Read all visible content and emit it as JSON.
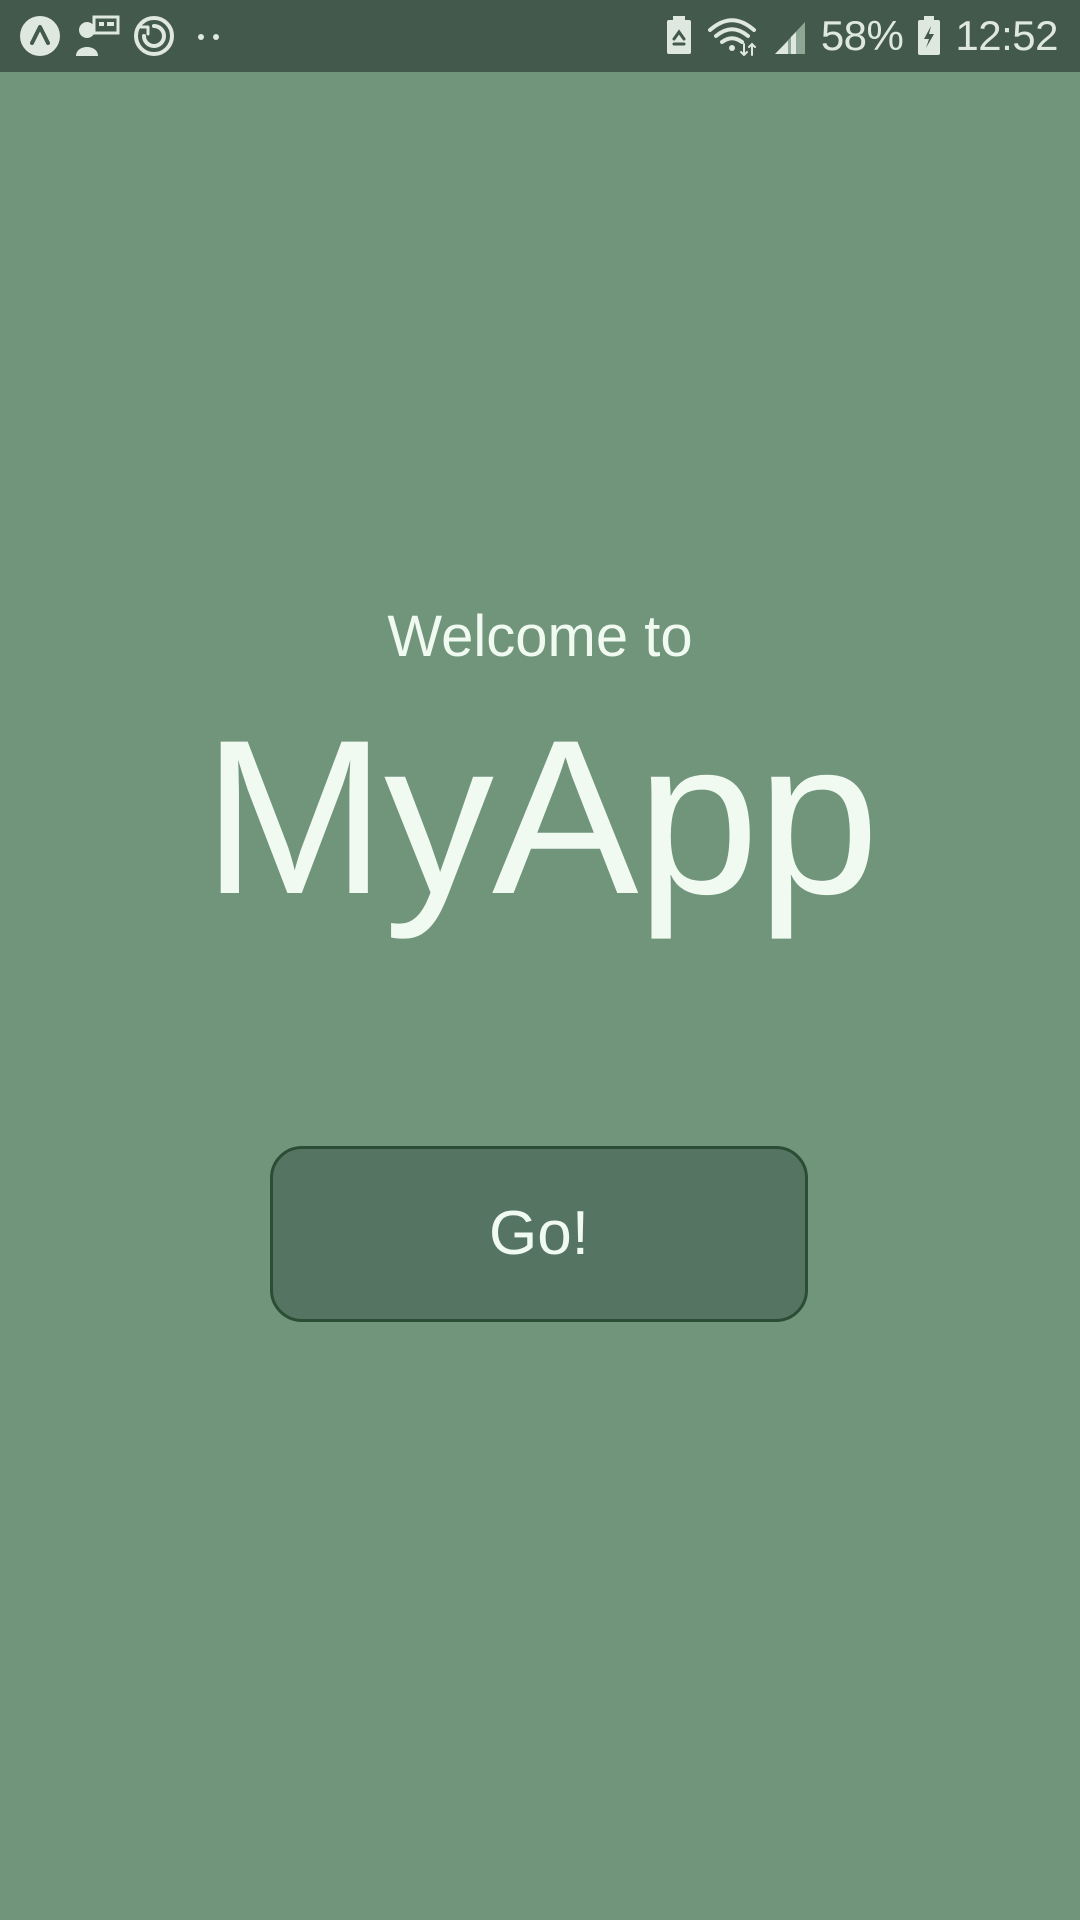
{
  "status_bar": {
    "battery_percent": "58%",
    "time": "12:52",
    "icons": [
      "app-circle-icon",
      "user-presentation-icon",
      "sync-circle-icon",
      "more-dots-icon",
      "battery-saver-icon",
      "wifi-icon",
      "signal-icon",
      "battery-icon"
    ]
  },
  "main": {
    "welcome_text": "Welcome to",
    "app_name": "MyApp",
    "go_button_label": "Go!"
  },
  "colors": {
    "background": "#71957b",
    "status_bar": "#43594c",
    "button_fill": "#557562",
    "button_border": "#2b4d35",
    "text": "#f0faf1"
  }
}
